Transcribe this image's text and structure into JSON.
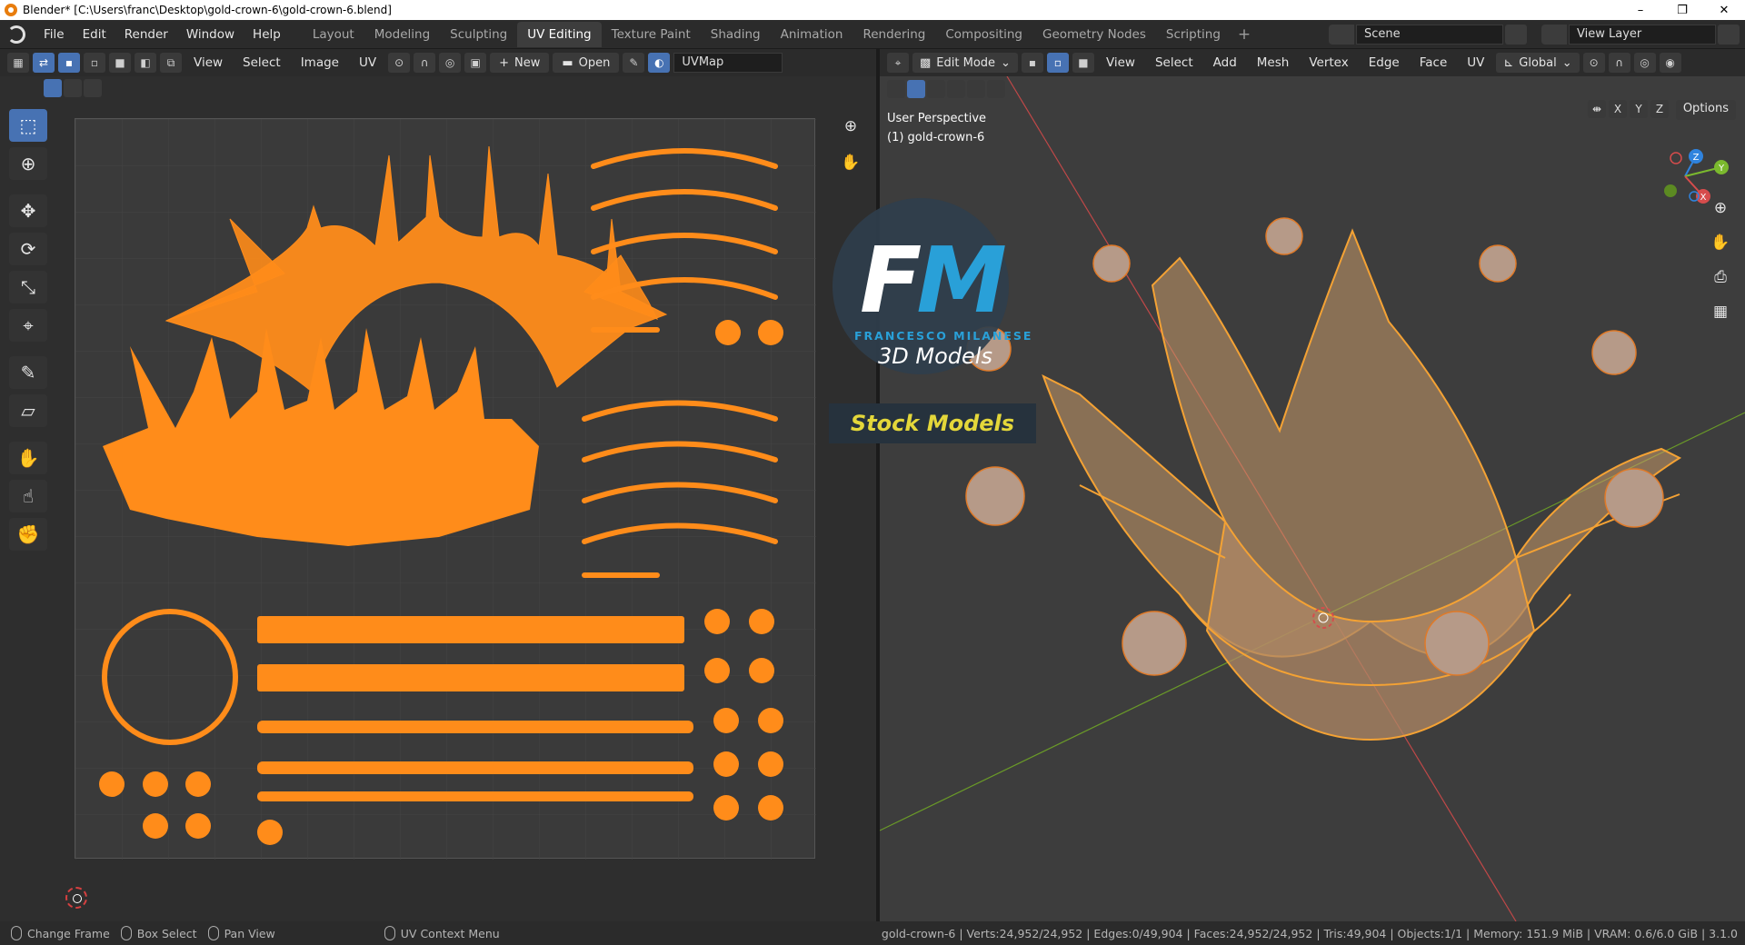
{
  "window": {
    "title": "Blender* [C:\\Users\\franc\\Desktop\\gold-crown-6\\gold-crown-6.blend]",
    "controls": [
      "–",
      "❐",
      "✕"
    ]
  },
  "menus": [
    "File",
    "Edit",
    "Render",
    "Window",
    "Help"
  ],
  "workspaces": [
    "Layout",
    "Modeling",
    "Sculpting",
    "UV Editing",
    "Texture Paint",
    "Shading",
    "Animation",
    "Rendering",
    "Compositing",
    "Geometry Nodes",
    "Scripting"
  ],
  "active_workspace": "UV Editing",
  "scene": {
    "value": "Scene"
  },
  "view_layer": {
    "value": "View Layer"
  },
  "uv_editor": {
    "menus": [
      "View",
      "Select",
      "Image",
      "UV"
    ],
    "new_label": "New",
    "open_label": "Open",
    "uvmap_value": "UVMap",
    "tools": [
      "select-box",
      "cursor",
      "move",
      "rotate",
      "scale",
      "transform",
      "annotate",
      "rip",
      "grab",
      "relax",
      "pinch"
    ]
  },
  "viewport": {
    "mode_label": "Edit Mode",
    "menus": [
      "View",
      "Select",
      "Add",
      "Mesh",
      "Vertex",
      "Edge",
      "Face",
      "UV"
    ],
    "transform_orientation": "Global",
    "axes": [
      "X",
      "Y",
      "Z"
    ],
    "options_label": "Options",
    "info_line1": "User Perspective",
    "info_line2": "(1) gold-crown-6",
    "gizmo_labels": [
      "Z",
      "Y",
      "X"
    ]
  },
  "watermark": {
    "letters_f": "F",
    "letters_m": "M",
    "name": "FRANCESCO MILANESE",
    "subtitle": "3D Models",
    "banner": "Stock Models"
  },
  "statusbar": {
    "items": [
      "Change Frame",
      "Box Select",
      "Pan View",
      "UV Context Menu"
    ],
    "stats": "gold-crown-6 | Verts:24,952/24,952 | Edges:0/49,904 | Faces:24,952/24,952 | Tris:49,904 | Objects:1/1 | Memory: 151.9 MiB | VRAM: 0.6/6.0 GiB | 3.1.0"
  },
  "colors": {
    "accent": "#4772b3",
    "uv_orange": "#ff8c1a",
    "mesh_orange": "#f4a234",
    "x_axis": "#d64c4c",
    "y_axis": "#7bb92e",
    "z_axis": "#2f83de"
  }
}
